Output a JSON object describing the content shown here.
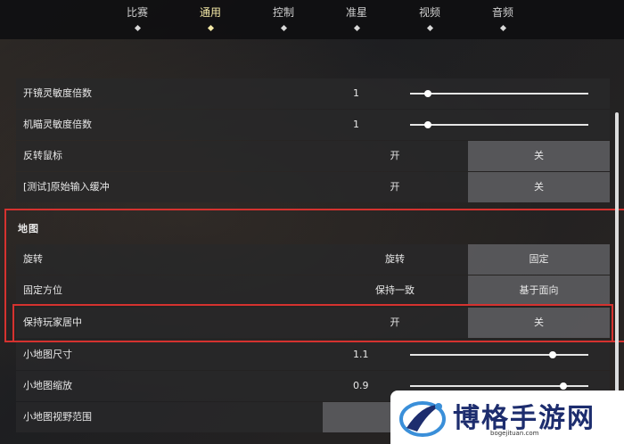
{
  "tabs": [
    {
      "label": "比赛",
      "active": false
    },
    {
      "label": "通用",
      "active": true
    },
    {
      "label": "控制",
      "active": false
    },
    {
      "label": "准星",
      "active": false
    },
    {
      "label": "视频",
      "active": false
    },
    {
      "label": "音频",
      "active": false
    }
  ],
  "rows_top": [
    {
      "label": "开镜灵敏度倍数",
      "value": "1",
      "slider_fraction": 0.1
    },
    {
      "label": "机瞄灵敏度倍数",
      "value": "1",
      "slider_fraction": 0.1
    }
  ],
  "toggle_rows_top": [
    {
      "label": "反转鼠标",
      "option_a": "开",
      "option_b": "关"
    },
    {
      "label": "[测试]原始输入缓冲",
      "option_a": "开",
      "option_b": "关"
    }
  ],
  "map_section": {
    "title": "地图",
    "rows": [
      {
        "label": "旋转",
        "option_a": "旋转",
        "option_b": "固定"
      },
      {
        "label": "固定方位",
        "option_a": "保持一致",
        "option_b": "基于面向"
      },
      {
        "label": "保持玩家居中",
        "option_a": "开",
        "option_b": "关"
      }
    ],
    "slider_rows": [
      {
        "label": "小地图尺寸",
        "value": "1.1",
        "slider_fraction": 0.8
      },
      {
        "label": "小地图缩放",
        "value": "0.9",
        "slider_fraction": 0.86
      }
    ],
    "last_row": {
      "label": "小地图视野范围",
      "option_a": "无"
    }
  },
  "watermark": {
    "title": "博格手游网",
    "url": "bogejituan.com"
  },
  "colors": {
    "active_tab": "#f3e8a6",
    "highlight_box": "#d5322f",
    "watermark_text": "#1d2d6e"
  }
}
